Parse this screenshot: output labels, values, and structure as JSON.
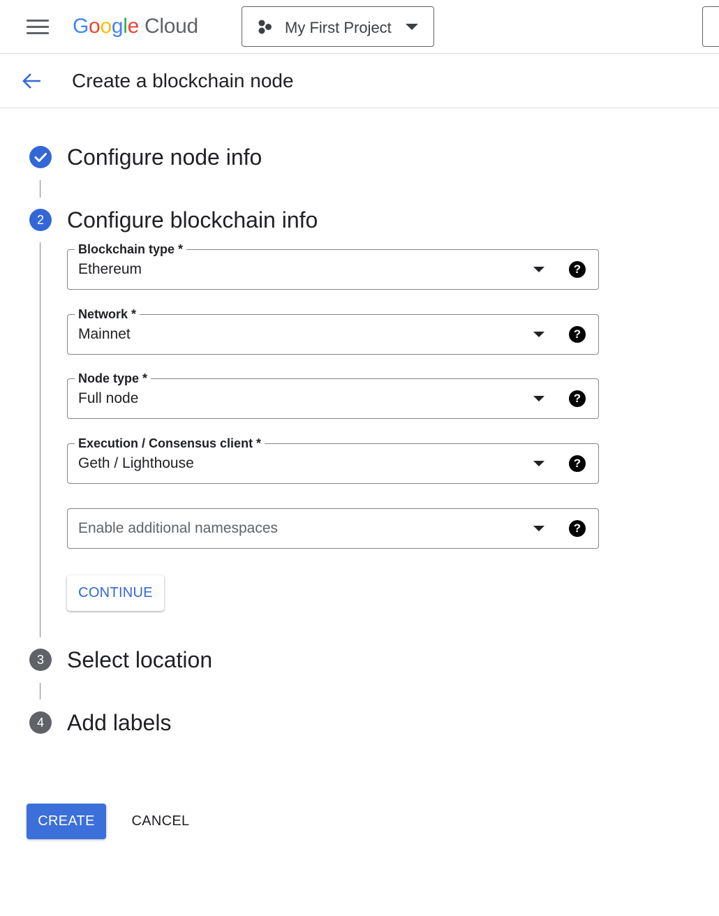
{
  "topbar": {
    "logo": {
      "letters": [
        "G",
        "o",
        "o",
        "g",
        "l",
        "e"
      ],
      "product": "Cloud"
    },
    "project": {
      "name": "My First Project",
      "icon": "project-hexagons-icon"
    }
  },
  "page": {
    "title": "Create a blockchain node"
  },
  "steps": [
    {
      "number": "1",
      "title": "Configure node info",
      "state": "completed"
    },
    {
      "number": "2",
      "title": "Configure blockchain info",
      "state": "active"
    },
    {
      "number": "3",
      "title": "Select location",
      "state": "pending"
    },
    {
      "number": "4",
      "title": "Add labels",
      "state": "pending"
    }
  ],
  "fields": {
    "blockchain_type": {
      "label": "Blockchain type *",
      "value": "Ethereum"
    },
    "network": {
      "label": "Network *",
      "value": "Mainnet"
    },
    "node_type": {
      "label": "Node type *",
      "value": "Full node"
    },
    "client": {
      "label": "Execution / Consensus client *",
      "value": "Geth / Lighthouse"
    },
    "namespaces": {
      "placeholder": "Enable additional namespaces"
    },
    "help_glyph": "?"
  },
  "buttons": {
    "continue": "CONTINUE",
    "create": "CREATE",
    "cancel": "CANCEL"
  },
  "colors": {
    "accent": "#3367d6",
    "primary_button": "#3b6fd9",
    "pending_step": "#5f6368"
  }
}
